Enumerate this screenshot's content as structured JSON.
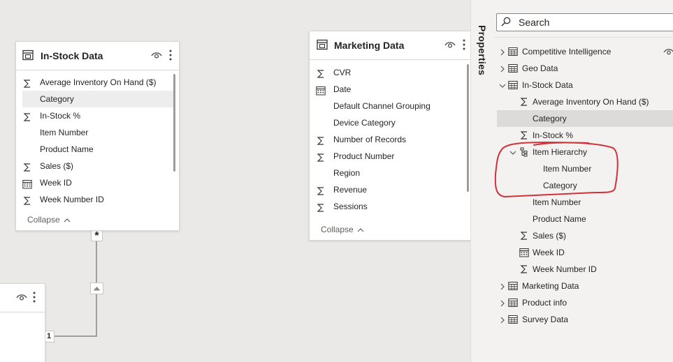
{
  "canvas": {
    "instock_card": {
      "title": "In-Stock Data",
      "fields": [
        {
          "label": "Average Inventory On Hand ($)",
          "icon": "sigma-icon"
        },
        {
          "label": "Category",
          "icon": "none"
        },
        {
          "label": "In-Stock %",
          "icon": "sigma-icon"
        },
        {
          "label": "Item Number",
          "icon": "none"
        },
        {
          "label": "Product Name",
          "icon": "none"
        },
        {
          "label": "Sales ($)",
          "icon": "sigma-icon"
        },
        {
          "label": "Week ID",
          "icon": "calendar-icon"
        },
        {
          "label": "Week Number ID",
          "icon": "sigma-icon"
        }
      ],
      "collapse_label": "Collapse"
    },
    "marketing_card": {
      "title": "Marketing Data",
      "fields": [
        {
          "label": "CVR",
          "icon": "sigma-icon"
        },
        {
          "label": "Date",
          "icon": "calendar-icon"
        },
        {
          "label": "Default Channel Grouping",
          "icon": "none"
        },
        {
          "label": "Device Category",
          "icon": "none"
        },
        {
          "label": "Number of Records",
          "icon": "sigma-icon"
        },
        {
          "label": "Product Number",
          "icon": "sigma-icon"
        },
        {
          "label": "Region",
          "icon": "none"
        },
        {
          "label": "Revenue",
          "icon": "sigma-icon"
        },
        {
          "label": "Sessions",
          "icon": "sigma-icon"
        }
      ],
      "collapse_label": "Collapse"
    },
    "relationship": {
      "many_marker": "*",
      "one_marker": "1"
    }
  },
  "properties_pane": {
    "label": "Properties"
  },
  "fields_pane": {
    "search": {
      "placeholder": "Search"
    },
    "tables": [
      {
        "label": "Competitive Intelligence",
        "expanded": false
      },
      {
        "label": "Geo Data",
        "expanded": false
      },
      {
        "label": "In-Stock Data",
        "expanded": true
      },
      {
        "label": "Marketing Data",
        "expanded": false
      },
      {
        "label": "Product info",
        "expanded": false
      },
      {
        "label": "Survey Data",
        "expanded": false
      }
    ],
    "instock_fields": [
      {
        "label": "Average Inventory On Hand ($)",
        "icon": "sigma-icon"
      },
      {
        "label": "Category",
        "icon": "none",
        "selected": true
      },
      {
        "label": "In-Stock %",
        "icon": "sigma-icon"
      },
      {
        "label": "Item Hierarchy",
        "icon": "hierarchy-icon",
        "expanded": true
      },
      {
        "label": "Item Number",
        "icon": "none"
      },
      {
        "label": "Product Name",
        "icon": "none"
      },
      {
        "label": "Sales ($)",
        "icon": "sigma-icon"
      },
      {
        "label": "Week ID",
        "icon": "calendar-icon"
      },
      {
        "label": "Week Number ID",
        "icon": "sigma-icon"
      }
    ],
    "hierarchy_levels": [
      {
        "label": "Item Number"
      },
      {
        "label": "Category"
      }
    ]
  },
  "colors": {
    "canvas_bg": "#eae9e8",
    "pane_bg": "#f3f2f1",
    "selected_row": "#dcdbd9",
    "annotation": "#d0313a"
  }
}
